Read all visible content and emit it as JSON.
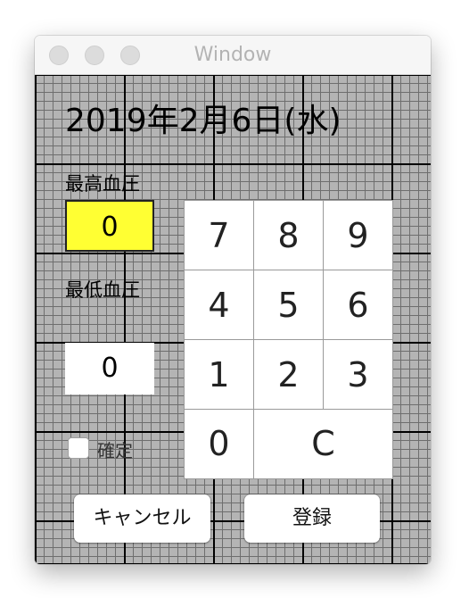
{
  "window": {
    "title": "Window"
  },
  "date": "2019年2月6日(水)",
  "systolic": {
    "label": "最高血圧",
    "value": "0",
    "highlight_color": "#ffff33"
  },
  "diastolic": {
    "label": "最低血圧",
    "value": "0"
  },
  "confirm": {
    "label": "確定",
    "checked": false
  },
  "keypad": {
    "keys": [
      {
        "label": "7",
        "name": "key-7"
      },
      {
        "label": "8",
        "name": "key-8"
      },
      {
        "label": "9",
        "name": "key-9"
      },
      {
        "label": "4",
        "name": "key-4"
      },
      {
        "label": "5",
        "name": "key-5"
      },
      {
        "label": "6",
        "name": "key-6"
      },
      {
        "label": "1",
        "name": "key-1"
      },
      {
        "label": "2",
        "name": "key-2"
      },
      {
        "label": "3",
        "name": "key-3"
      },
      {
        "label": "0",
        "name": "key-0"
      },
      {
        "label": "C",
        "name": "key-clear"
      }
    ]
  },
  "buttons": {
    "cancel_label": "キャンセル",
    "register_label": "登録"
  }
}
